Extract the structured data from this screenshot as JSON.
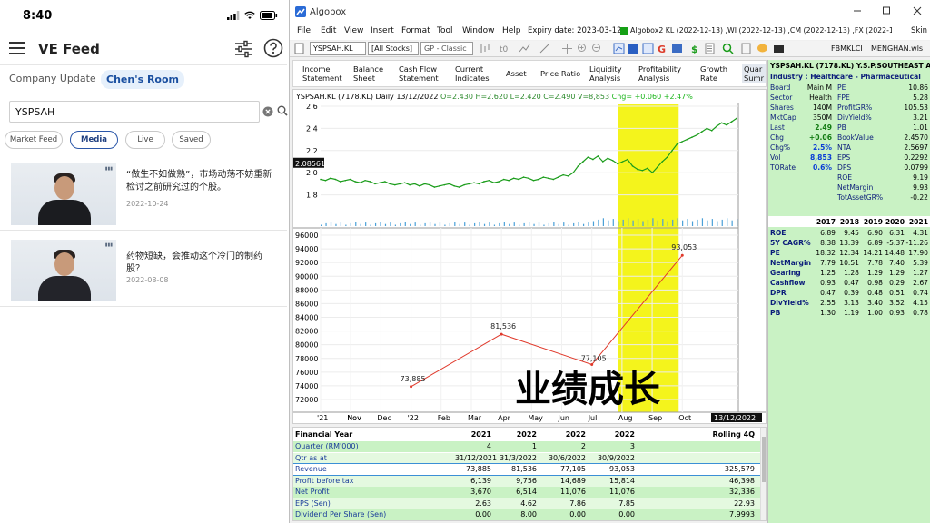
{
  "phone": {
    "status_time": "8:40",
    "app_title": "VE Feed",
    "room_tabs": [
      "Company Update",
      "Chen's Room"
    ],
    "search_value": "YSPSAH",
    "feed_tabs": [
      "Market Feed",
      "Media",
      "Live",
      "Saved"
    ],
    "active_feed_tab": "Media",
    "feed_items": [
      {
        "title": "“做生不如做熟”，市场动荡不妨重新检讨之前研究过的个股。",
        "date": "2022-10-24"
      },
      {
        "title": "药物短缺，会推动这个冷门的制药股？",
        "date": "2022-08-08"
      }
    ]
  },
  "window": {
    "title": "Algobox",
    "menu": [
      "File",
      "Edit",
      "View",
      "Insert",
      "Format",
      "Tool",
      "Window",
      "Help"
    ],
    "expiry": "Expiry date: 2023-03-12",
    "algobox_status": "Algobox2 KL (2022-12-13) ,WI (2022-12-13) ,CM (2022-12-13) ,FX (2022-12-13) -> H",
    "skin_label": "Skin",
    "toolbar": {
      "symbol_combo": "YSPSAH.KL",
      "list_combo": "[All Stocks]",
      "layout_combo": "GP - Classic",
      "index_label": "FBMKLCI",
      "workspace_label": "MENGHAN.wls"
    }
  },
  "tabs": [
    "Income\nStatement",
    "Balance\nSheet",
    "Cash Flow\nStatement",
    "Current\nIndicates",
    "Asset",
    "Price Ratio",
    "Liquidity\nAnalysis",
    "Profitability\nAnalysis",
    "Growth\nRate",
    "Quar\nSumr"
  ],
  "price_bar": {
    "symbol": "YSPSAH.KL (7178.KL) Daily",
    "date": "13/12/2022",
    "open": "O=2.430",
    "high": "H=2.620",
    "low": "L=2.420",
    "close": "C=2.490",
    "volume": "V=8,853",
    "change": "Chg= +0.060",
    "change_pct": "+2.47%",
    "cursor_price": "2.08561"
  },
  "chart_data": [
    {
      "type": "line",
      "ylim": [
        1.6,
        2.6
      ],
      "y_ticks": [
        "2.6",
        "2.4",
        "2.2",
        "2.0",
        "1.8"
      ],
      "series": [
        {
          "values": [
            1.94,
            1.93,
            1.95,
            1.94,
            1.92,
            1.93,
            1.94,
            1.92,
            1.91,
            1.93,
            1.92,
            1.9,
            1.91,
            1.92,
            1.9,
            1.89,
            1.9,
            1.91,
            1.89,
            1.9,
            1.88,
            1.9,
            1.89,
            1.87,
            1.88,
            1.89,
            1.9,
            1.88,
            1.87,
            1.89,
            1.9,
            1.91,
            1.9,
            1.92,
            1.93,
            1.91,
            1.92,
            1.94,
            1.93,
            1.95,
            1.94,
            1.96,
            1.95,
            1.93,
            1.94,
            1.96,
            1.95,
            1.94,
            1.96,
            1.98,
            1.97,
            2.0,
            2.06,
            2.1,
            2.14,
            2.12,
            2.15,
            2.1,
            2.13,
            2.11,
            2.08,
            2.1,
            2.12,
            2.06,
            2.03,
            2.02,
            2.04,
            2.0,
            2.05,
            2.1,
            2.14,
            2.2,
            2.26,
            2.28,
            2.3,
            2.32,
            2.34,
            2.37,
            2.4,
            2.38,
            2.42,
            2.45,
            2.43,
            2.46,
            2.49
          ]
        }
      ],
      "highlight": [
        "Aug",
        "Sep"
      ]
    },
    {
      "type": "line",
      "ylim": [
        72000,
        96000
      ],
      "y_ticks": [
        "96000",
        "94000",
        "92000",
        "90000",
        "88000",
        "86000",
        "84000",
        "82000",
        "80000",
        "78000",
        "76000",
        "74000",
        "72000"
      ],
      "x_ticks": [
        "'21",
        "Nov",
        "Dec",
        "'22",
        "Feb",
        "Mar",
        "Apr",
        "May",
        "Jun",
        "Jul",
        "Aug",
        "Sep",
        "Oct",
        "Nov"
      ],
      "x_end_label": "13/12/2022",
      "series": [
        {
          "points": [
            {
              "x": "'22",
              "y": 73885,
              "label": "73,885"
            },
            {
              "x": "Apr",
              "y": 81536,
              "label": "81,536"
            },
            {
              "x": "Jul",
              "y": 77105,
              "label": "77,105"
            },
            {
              "x": "Oct",
              "y": 93053,
              "label": "93,053"
            }
          ]
        }
      ],
      "annotation": "业绩成长",
      "highlight": [
        "Aug",
        "Sep"
      ]
    }
  ],
  "table": {
    "headers": [
      "Financial Year",
      "2021",
      "2022",
      "2022",
      "2022",
      "Rolling 4Q"
    ],
    "rows": [
      {
        "label": "Quarter (RM'000)",
        "cells": [
          "4",
          "1",
          "2",
          "3",
          ""
        ]
      },
      {
        "label": "Qtr as at",
        "cells": [
          "31/12/2021",
          "31/3/2022",
          "30/6/2022",
          "30/9/2022",
          ""
        ]
      },
      {
        "label": "Revenue",
        "cells": [
          "73,885",
          "81,536",
          "77,105",
          "93,053",
          "325,579"
        ]
      },
      {
        "label": "Profit before tax",
        "cells": [
          "6,139",
          "9,756",
          "14,689",
          "15,814",
          "46,398"
        ]
      },
      {
        "label": "Net Profit",
        "cells": [
          "3,670",
          "6,514",
          "11,076",
          "11,076",
          "32,336"
        ]
      },
      {
        "label": "EPS (Sen)",
        "cells": [
          "2.63",
          "4.62",
          "7.86",
          "7.85",
          "22.93"
        ]
      },
      {
        "label": "Dividend Per Share (Sen)",
        "cells": [
          "0.00",
          "8.00",
          "0.00",
          "0.00",
          "7.9993"
        ]
      }
    ]
  },
  "rightbar": {
    "header": "YSPSAH.KL (7178.KL) Y.S.P.SOUTHEAST ASIA",
    "industry": "Industry : Healthcare - Pharmaceutical",
    "left": [
      {
        "k": "Board",
        "v": "Main M"
      },
      {
        "k": "Sector",
        "v": "Health"
      },
      {
        "k": "Shares",
        "v": "140M"
      },
      {
        "k": "MktCap",
        "v": "350M"
      },
      {
        "k": "Last",
        "v": "2.49"
      },
      {
        "k": "Chg",
        "v": "+0.06"
      },
      {
        "k": "Chg%",
        "v": "2.5%"
      },
      {
        "k": "Vol",
        "v": "8,853"
      },
      {
        "k": "TORate",
        "v": "0.6%"
      }
    ],
    "right": [
      {
        "k": "PE",
        "v": "10.86"
      },
      {
        "k": "FPE",
        "v": "5.28"
      },
      {
        "k": "ProfitGR%",
        "v": "105.53"
      },
      {
        "k": "DivYield%",
        "v": "3.21"
      },
      {
        "k": "PB",
        "v": "1.01"
      },
      {
        "k": "BookValue",
        "v": "2.4570"
      },
      {
        "k": "NTA",
        "v": "2.5697"
      },
      {
        "k": "EPS",
        "v": "0.2292"
      },
      {
        "k": "DPS",
        "v": "0.0799"
      },
      {
        "k": "ROE",
        "v": "9.19"
      },
      {
        "k": "NetMargin",
        "v": "9.93"
      },
      {
        "k": "TotAssetGR%",
        "v": "-0.22"
      }
    ],
    "ratio_years": [
      "2017",
      "2018",
      "2019",
      "2020",
      "2021"
    ],
    "ratios": [
      {
        "name": "ROE",
        "vals": [
          "6.89",
          "9.45",
          "6.90",
          "6.31",
          "4.31"
        ]
      },
      {
        "name": "5Y CAGR%",
        "vals": [
          "8.38",
          "13.39",
          "6.89",
          "-5.37",
          "-11.26"
        ]
      },
      {
        "name": "PE",
        "vals": [
          "18.32",
          "12.34",
          "14.21",
          "14.48",
          "17.90"
        ]
      },
      {
        "name": "NetMargin",
        "vals": [
          "7.79",
          "10.51",
          "7.78",
          "7.40",
          "5.39"
        ]
      },
      {
        "name": "Gearing",
        "vals": [
          "1.25",
          "1.28",
          "1.29",
          "1.29",
          "1.27"
        ]
      },
      {
        "name": "Cashflow",
        "vals": [
          "0.93",
          "0.47",
          "0.98",
          "0.29",
          "2.67"
        ]
      },
      {
        "name": "DPR",
        "vals": [
          "0.47",
          "0.39",
          "0.48",
          "0.51",
          "0.74"
        ]
      },
      {
        "name": "DivYield%",
        "vals": [
          "2.55",
          "3.13",
          "3.40",
          "3.52",
          "4.15"
        ]
      },
      {
        "name": "PB",
        "vals": [
          "1.30",
          "1.19",
          "1.00",
          "0.93",
          "0.78"
        ]
      }
    ]
  },
  "colors": {
    "highlight": "#f4f41c",
    "line_red": "#e0392b",
    "price_green": "#1a9c1a",
    "rightbar_bg": "#c9f2c4"
  }
}
